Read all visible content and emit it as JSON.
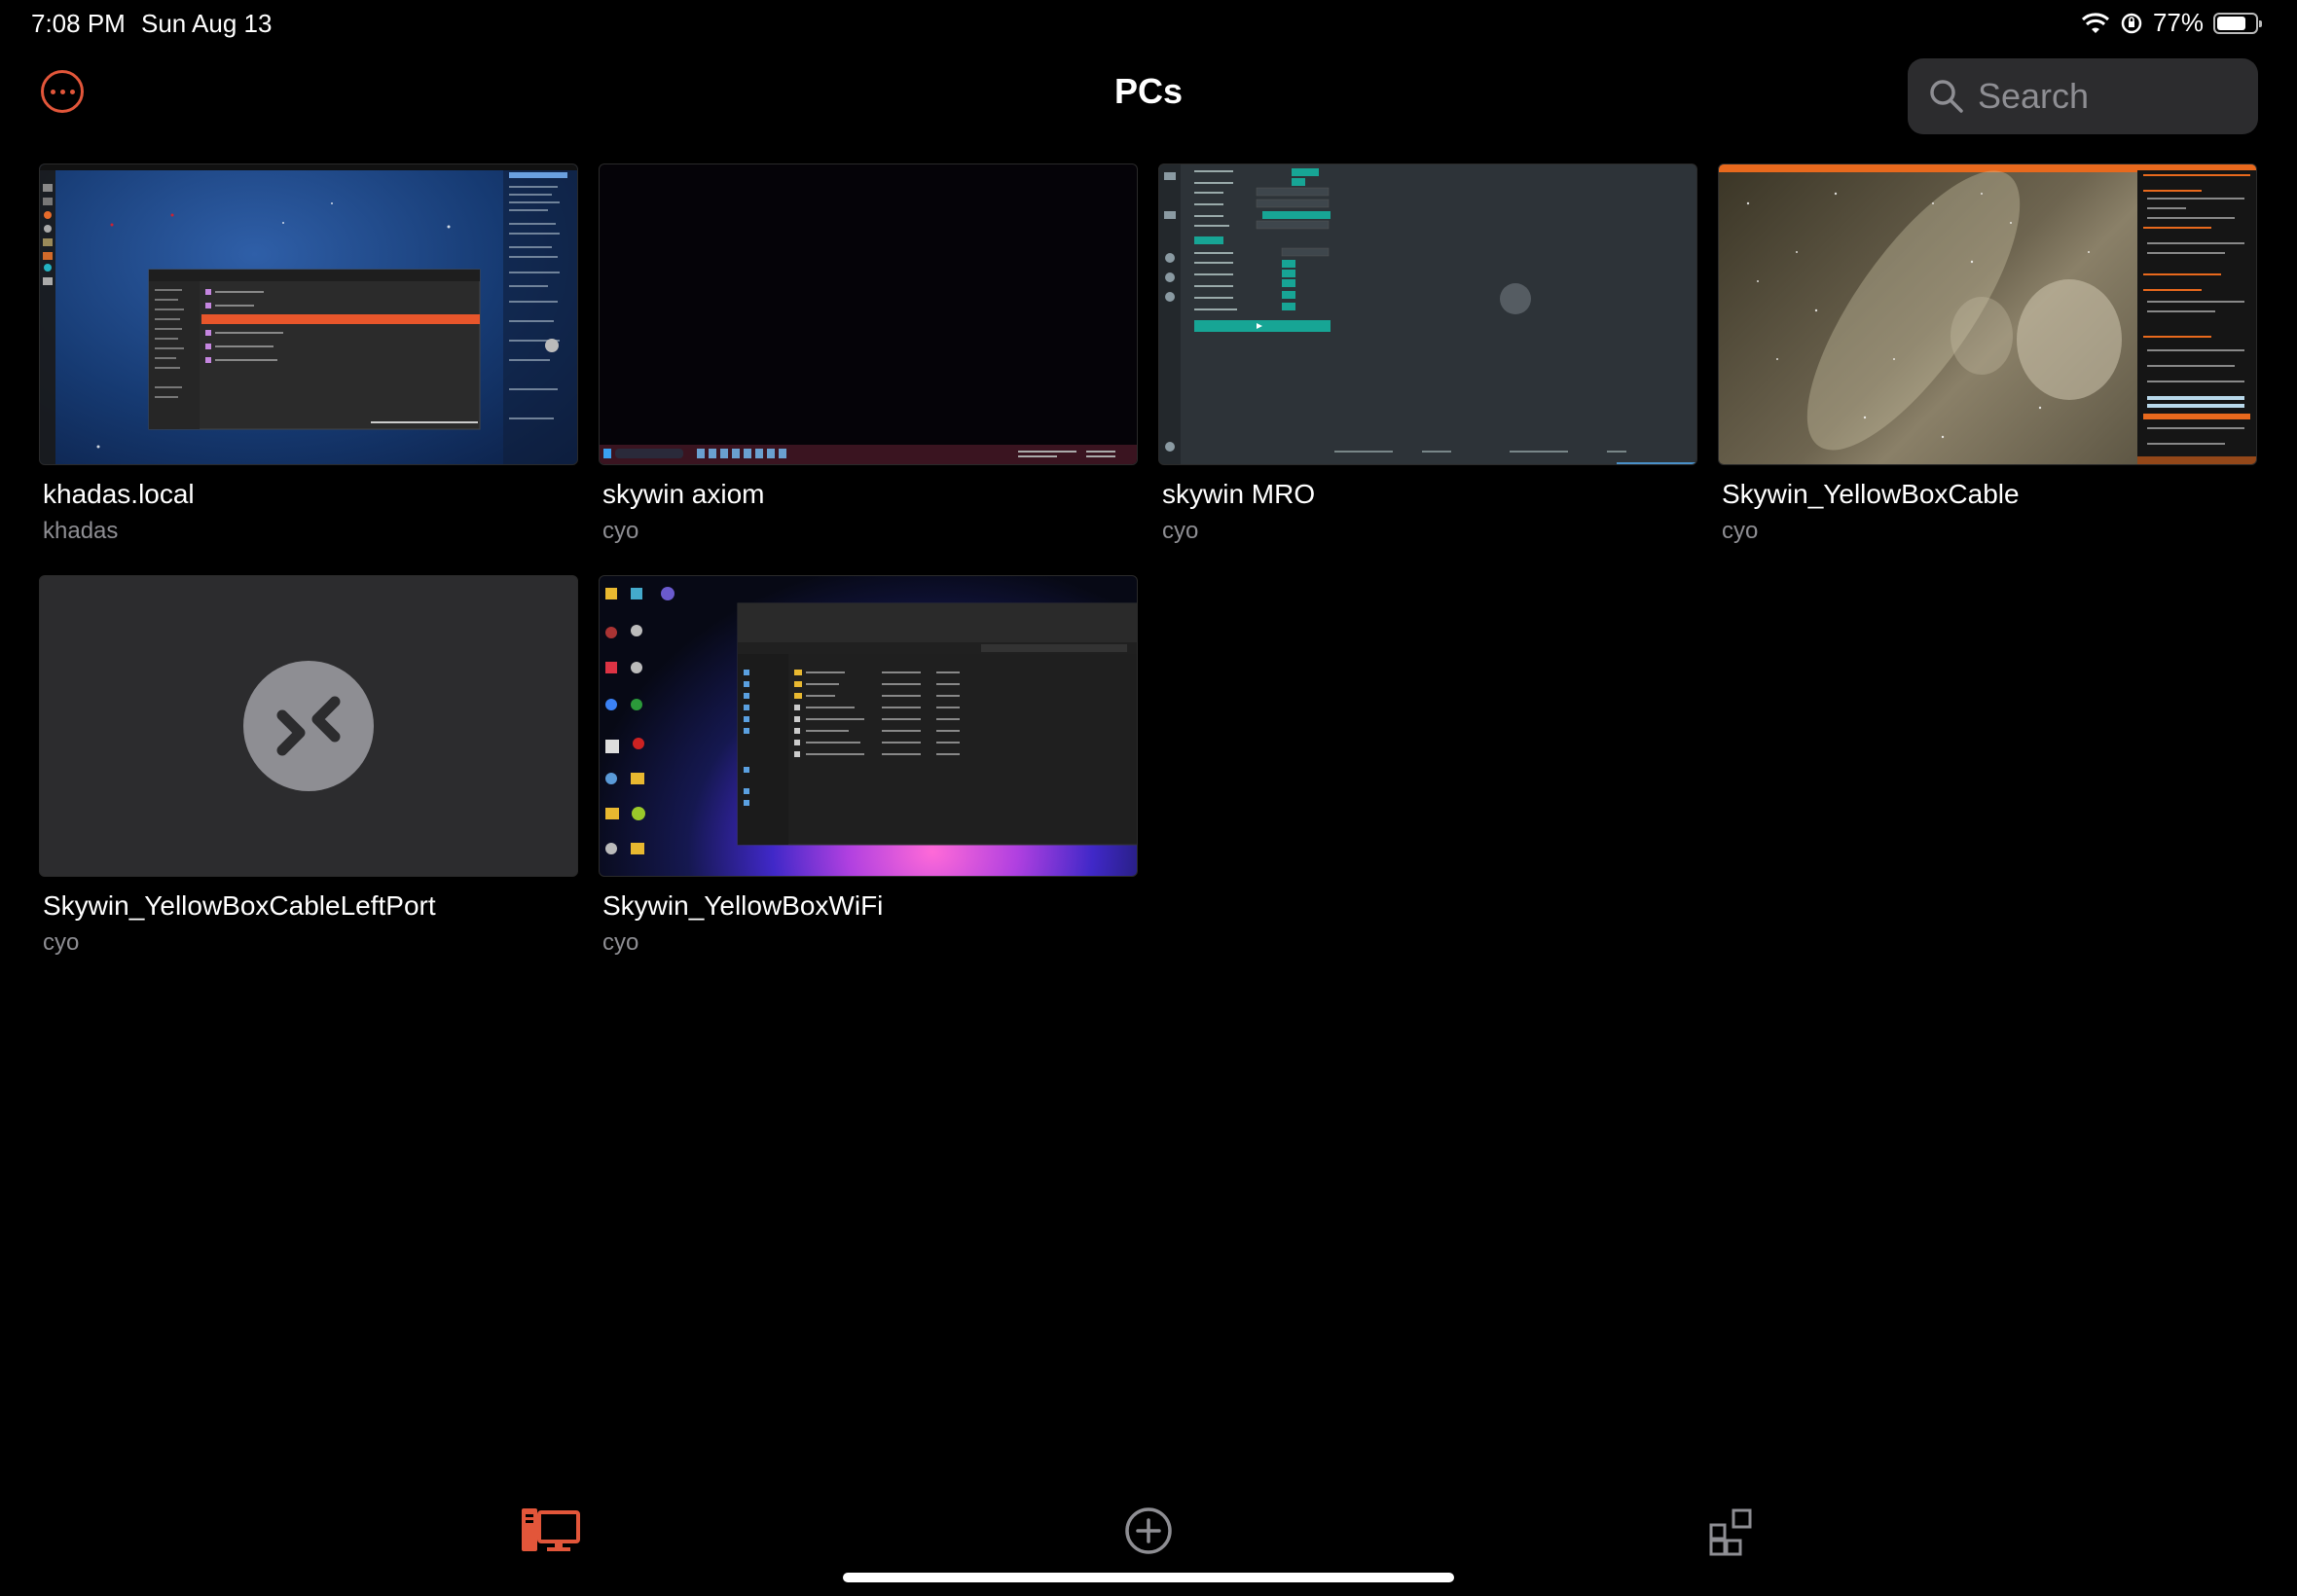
{
  "status_bar": {
    "time": "7:08 PM",
    "date": "Sun Aug 13",
    "battery_percent": "77%",
    "battery_level": 0.77,
    "icons": [
      "wifi-icon",
      "orientation-lock-icon",
      "battery-icon"
    ]
  },
  "header": {
    "title": "PCs",
    "more_icon": "ellipsis-circle-icon",
    "search": {
      "placeholder": "Search",
      "value": ""
    }
  },
  "pcs": [
    {
      "name": "khadas.local",
      "user": "khadas",
      "thumbnail": "linux-desktop"
    },
    {
      "name": "skywin axiom",
      "user": "cyo",
      "thumbnail": "dark-windows-desktop"
    },
    {
      "name": "skywin MRO",
      "user": "cyo",
      "thumbnail": "teal-app-panel"
    },
    {
      "name": "Skywin_YellowBoxCable",
      "user": "cyo",
      "thumbnail": "milky-way-capture"
    },
    {
      "name": "Skywin_YellowBoxCableLeftPort",
      "user": "cyo",
      "thumbnail": "remote-desktop-placeholder"
    },
    {
      "name": "Skywin_YellowBoxWiFi",
      "user": "cyo",
      "thumbnail": "windows-11-bloom-desktop"
    }
  ],
  "tabs": [
    {
      "icon": "pcs-icon",
      "active": true
    },
    {
      "icon": "add-circle-icon",
      "active": false
    },
    {
      "icon": "apps-grid-icon",
      "active": false
    }
  ],
  "colors": {
    "accent": "#e2563a",
    "background": "#000000",
    "secondary_text": "#8e8e93",
    "search_bg": "#2c2c2e"
  }
}
